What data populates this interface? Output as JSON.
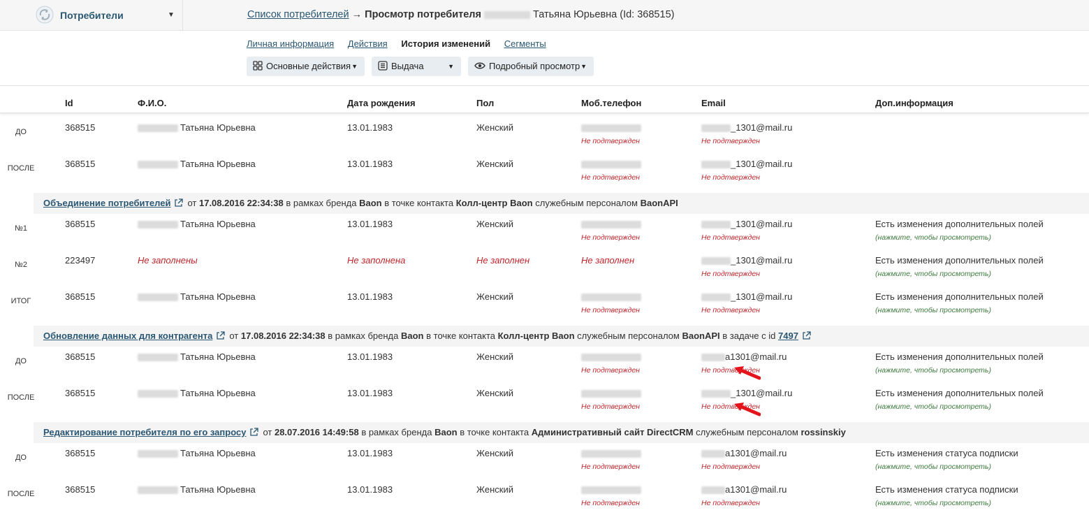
{
  "header": {
    "section": "Потребители",
    "breadcrumb_link": "Список потребителей",
    "breadcrumb_arrow": "→",
    "breadcrumb_current": "Просмотр потребителя",
    "person": "Татьяна Юрьевна (Id: 368515)"
  },
  "tabs": [
    {
      "label": "Личная информация"
    },
    {
      "label": "Действия"
    },
    {
      "label": "История изменений"
    },
    {
      "label": "Сегменты"
    }
  ],
  "buttons": {
    "actions": "Основные действия",
    "issue": "Выдача",
    "view": "Подробный просмотр"
  },
  "columns": {
    "id": "Id",
    "name": "Ф.И.О.",
    "birth": "Дата рождения",
    "gender": "Пол",
    "phone": "Моб.телефон",
    "email": "Email",
    "extra": "Доп.информация"
  },
  "rows": [
    {
      "label": "ДО",
      "id": "368515",
      "name": "Татьяна Юрьевна",
      "birth": "13.01.1983",
      "gender": "Женский",
      "phone_status": "Не подтвержден",
      "email": "_1301@mail.ru",
      "email_status": "Не подтвержден",
      "extra": "",
      "extra_hint": ""
    },
    {
      "label": "ПОСЛЕ",
      "id": "368515",
      "name": "Татьяна Юрьевна",
      "birth": "13.01.1983",
      "gender": "Женский",
      "phone_status": "Не подтвержден",
      "email": "_1301@mail.ru",
      "email_status": "Не подтвержден",
      "extra": "",
      "extra_hint": ""
    },
    {
      "label": "№1",
      "id": "368515",
      "name": "Татьяна Юрьевна",
      "birth": "13.01.1983",
      "gender": "Женский",
      "phone_status": "Не подтвержден",
      "email": "_1301@mail.ru",
      "email_status": "Не подтвержден",
      "extra": "Есть изменения дополнительных полей",
      "extra_hint": "(нажмите, чтобы просмотреть)"
    },
    {
      "label": "№2",
      "id": "223497",
      "name": "Не заполнены",
      "birth": "Не заполнена",
      "gender": "Не заполнен",
      "phone": "Не заполнен",
      "email": "_1301@mail.ru",
      "email_status": "Не подтвержден",
      "extra": "Есть изменения дополнительных полей",
      "extra_hint": "(нажмите, чтобы просмотреть)"
    },
    {
      "label": "ИТОГ",
      "id": "368515",
      "name": "Татьяна Юрьевна",
      "birth": "13.01.1983",
      "gender": "Женский",
      "phone_status": "Не подтвержден",
      "email": "_1301@mail.ru",
      "email_status": "Не подтвержден",
      "extra": "Есть изменения дополнительных полей",
      "extra_hint": "(нажмите, чтобы просмотреть)"
    },
    {
      "label": "ДО",
      "id": "368515",
      "name": "Татьяна Юрьевна",
      "birth": "13.01.1983",
      "gender": "Женский",
      "phone_status": "Не подтвержден",
      "email": "a1301@mail.ru",
      "email_status": "Не подтвержден",
      "extra": "Есть изменения дополнительных полей",
      "extra_hint": "(нажмите, чтобы просмотреть)"
    },
    {
      "label": "ПОСЛЕ",
      "id": "368515",
      "name": "Татьяна Юрьевна",
      "birth": "13.01.1983",
      "gender": "Женский",
      "phone_status": "Не подтвержден",
      "email": "_1301@mail.ru",
      "email_status": "Не подтвержден",
      "extra": "Есть изменения дополнительных полей",
      "extra_hint": "(нажмите, чтобы просмотреть)"
    },
    {
      "label": "ДО",
      "id": "368515",
      "name": "Татьяна Юрьевна",
      "birth": "13.01.1983",
      "gender": "Женский",
      "phone_status": "Не подтвержден",
      "email": "a1301@mail.ru",
      "email_status": "Не подтвержден",
      "extra": "Есть изменения статуса подписки",
      "extra_hint": "(нажмите, чтобы просмотреть)"
    },
    {
      "label": "ПОСЛЕ",
      "id": "368515",
      "name": "Татьяна Юрьевна",
      "birth": "13.01.1983",
      "gender": "Женский",
      "phone_status": "Не подтвержден",
      "email": "a1301@mail.ru",
      "email_status": "Не подтвержден",
      "extra": "Есть изменения статуса подписки",
      "extra_hint": "(нажмите, чтобы просмотреть)"
    }
  ],
  "events": [
    {
      "title": "Объединение потребителей",
      "from": "от",
      "date": "17.08.2016 22:34:38",
      "brand_pre": "в рамках бренда",
      "brand": "Baon",
      "point_pre": "в точке контакта",
      "point": "Колл-центр Baon",
      "staff_pre": "служебным персоналом",
      "staff": "BaonAPI"
    },
    {
      "title": "Обновление данных для контрагента",
      "from": "от",
      "date": "17.08.2016 22:34:38",
      "brand_pre": "в рамках бренда",
      "brand": "Baon",
      "point_pre": "в точке контакта",
      "point": "Колл-центр Baon",
      "staff_pre": "служебным персоналом",
      "staff": "BaonAPI",
      "task_pre": "в задаче с id",
      "task_id": "7497"
    },
    {
      "title": "Редактирование потребителя по его запросу",
      "from": "от",
      "date": "28.07.2016 14:49:58",
      "brand_pre": "в рамках бренда",
      "brand": "Baon",
      "point_pre": "в точке контакта",
      "point": "Административный сайт DirectCRM",
      "staff_pre": "служебным персоналом",
      "staff": "rossinskiy"
    }
  ],
  "colors": {
    "link": "#2a5773",
    "warning": "#c0272d",
    "hint": "#3d7a3d",
    "button_bg": "#e8edf1",
    "annotation_arrow": "#e3141b"
  }
}
